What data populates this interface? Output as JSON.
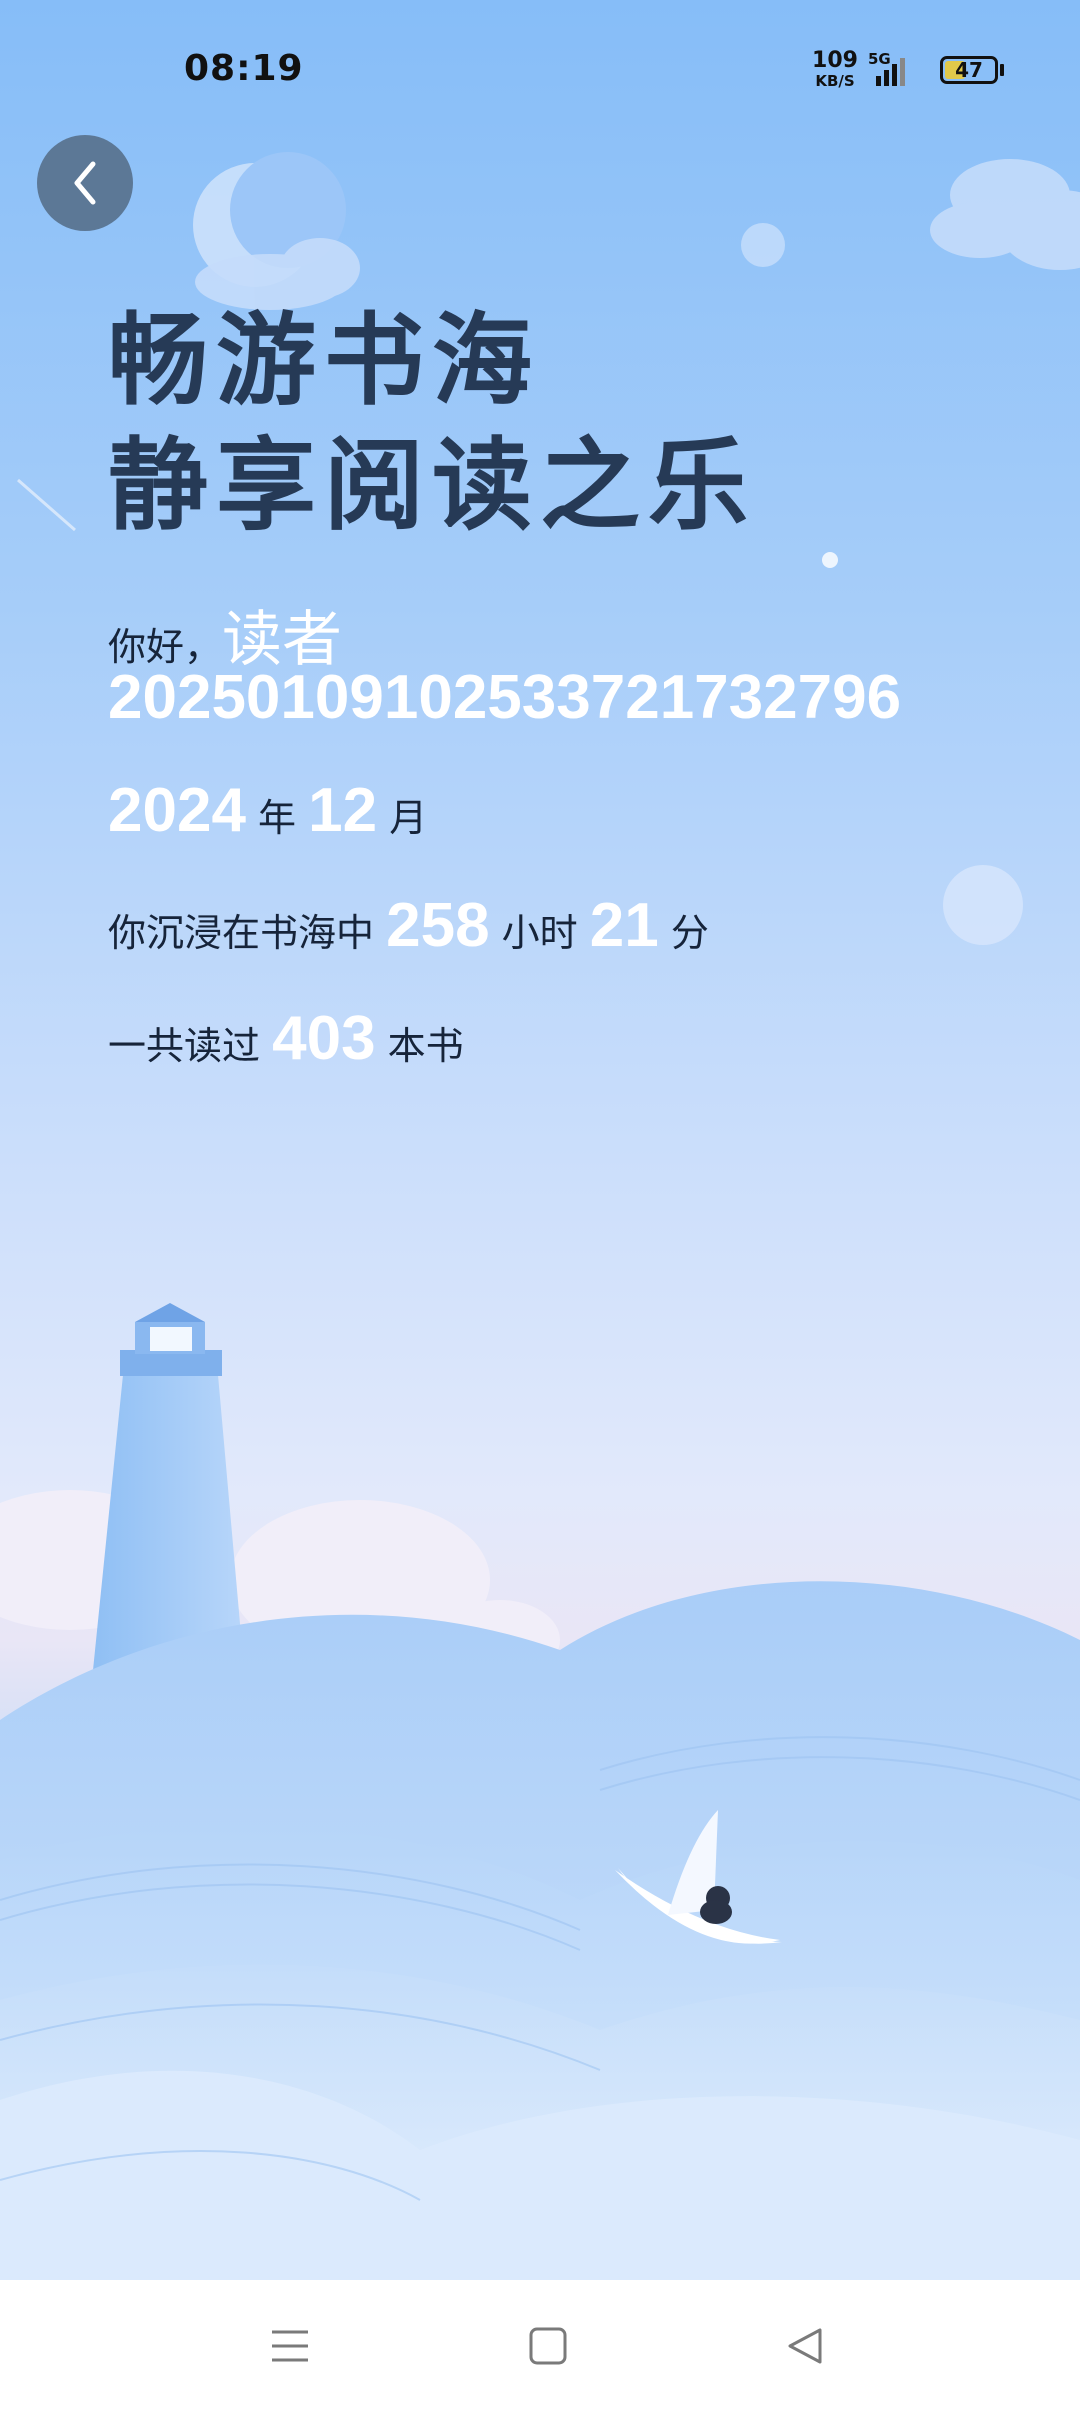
{
  "status_bar": {
    "time": "08:19",
    "net_speed": "109",
    "net_speed_unit": "KB/S",
    "network_type": "5G",
    "battery_level": "47",
    "battery_fraction": 0.47,
    "icons": [
      "signal-icon",
      "battery-icon"
    ]
  },
  "back_button": {
    "icon": "chevron-left-icon"
  },
  "headline": {
    "line1": "畅游书海",
    "line2": "静享阅读之乐"
  },
  "greeting": {
    "prefix": "你好，",
    "reader_word": "读者",
    "reader_id": "20250109102533721732796"
  },
  "date": {
    "year": "2024",
    "year_unit": "年",
    "month": "12",
    "month_unit": "月"
  },
  "reading_time": {
    "prefix": "你沉浸在书海中",
    "hours": "258",
    "hours_unit": "小时",
    "minutes": "21",
    "minutes_unit": "分"
  },
  "books": {
    "prefix": "一共读过",
    "count": "403",
    "unit": "本书"
  },
  "nav_bar": {
    "icons": [
      "menu-icon",
      "home-icon",
      "back-icon"
    ]
  },
  "colors": {
    "headline": "#263a56",
    "highlight": "#ffffff",
    "back_button": "#5c7896",
    "sky_top": "#86bdf8"
  }
}
